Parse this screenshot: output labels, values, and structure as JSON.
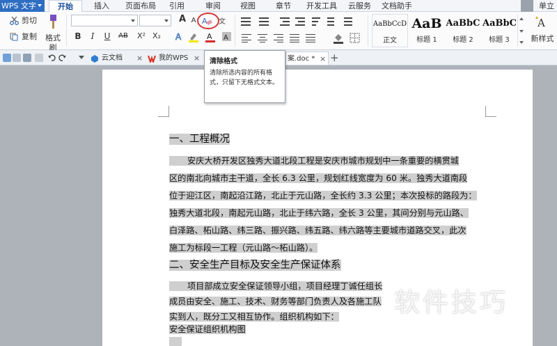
{
  "menubar": {
    "app_name": "WPS 文字",
    "tabs": [
      "开始",
      "插入",
      "页面布局",
      "引用",
      "审阅",
      "视图",
      "章节",
      "开发工具",
      "云服务",
      "文档助手"
    ],
    "active_tab": "开始",
    "user_label": "单立"
  },
  "ribbon": {
    "cut": "剪切",
    "copy": "复制",
    "format_painter": "格式刷",
    "bold": "B",
    "italic": "I",
    "underline": "U",
    "strike": "AB",
    "superscript": "X²",
    "subscript": "X₂",
    "grow": "A",
    "shrink": "A",
    "styles": [
      {
        "sample": "AaBbCcD",
        "name": "正文"
      },
      {
        "sample": "AaB",
        "name": "标题 1"
      },
      {
        "sample": "AaBbC",
        "name": "标题 2"
      },
      {
        "sample": "AaBbC",
        "name": "标题 3"
      }
    ],
    "new_style": "新样式"
  },
  "tabs_bar": {
    "tabs": [
      {
        "label": "云文档"
      },
      {
        "label": "我的WPS"
      },
      {
        "label": "案.doc *"
      }
    ]
  },
  "tooltip": {
    "title": "清除格式",
    "body": "清除所选内容的所有格式，只留下无格式文本。"
  },
  "document": {
    "lines": [
      "一、工程概况",
      "安庆大桥开发区独秀大道北段工程是安庆市城市规划中一条重要的横贯城",
      "区的南北向城市主干道，全长 6.3 公里，规划红线宽度为 60 米。独秀大道南段",
      "位于迎江区，南起沿江路，北止于元山路，全长约 3.3 公里；本次投标的路段为：",
      "独秀大道北段，南起元山路，北止于纬六路，全长 3 公里，其间分别与元山路、",
      "白泽路、柘山路、纬三路、振兴路、纬五路、纬六路等主要城市道路交叉，此次",
      "施工为标段一工程（元山路～柘山路）。",
      "二、安全生产目标及安全生产保证体系",
      "项目部成立安全保证领导小组，项目经理丁诚任组长",
      "成员由安全、施工、技术、财务等部门负责人及各施工队",
      "实到人，既分工又相互协作。组织机构如下：",
      "安全保证组织机构图"
    ]
  },
  "watermark": "软件技巧"
}
